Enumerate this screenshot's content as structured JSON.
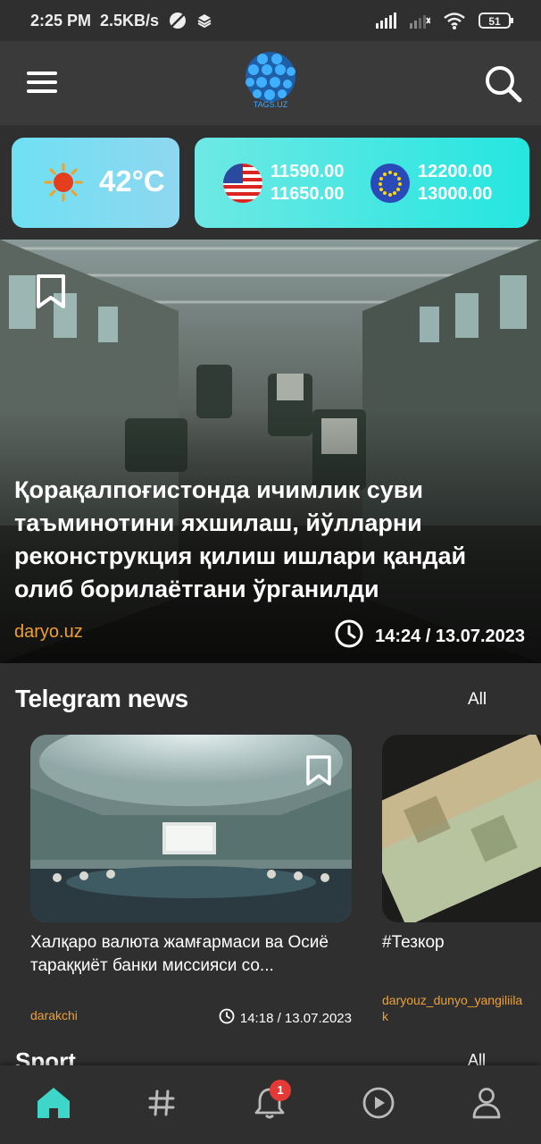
{
  "status_bar": {
    "time": "2:25 PM",
    "speed": "2.5KB/s",
    "battery": "51",
    "icons": [
      "no-sync-icon",
      "layers-icon",
      "signal-icon",
      "signal-weak-icon",
      "wifi-icon",
      "battery-icon"
    ]
  },
  "header": {
    "logo_text": "TAGS.UZ",
    "menu_icon": "hamburger-menu-icon",
    "search_icon": "search-icon"
  },
  "weather": {
    "icon": "sun-icon",
    "temperature": "42°C"
  },
  "currency": {
    "usd": {
      "flag": "usa-flag-icon",
      "buy": "11590.00",
      "sell": "11650.00"
    },
    "eur": {
      "flag": "eu-flag-icon",
      "buy": "12200.00",
      "sell": "13000.00"
    }
  },
  "hero": {
    "title": "Қорақалпоғистонда ичимлик суви таъминотини яхшилаш, йўлларни реконструкция қилиш ишлари қандай олиб борилаётгани ўрганилди",
    "source": "daryo.uz",
    "time": "14:24 / 13.07.2023"
  },
  "telegram_news": {
    "title": "Telegram news",
    "all_label": "All",
    "cards": [
      {
        "title": "Халқаро валюта жамғармаси ва Осиё тараққиёт банки миссияси со...",
        "source": "darakchi",
        "time": "14:18 / 13.07.2023"
      },
      {
        "title": "#Тезкор",
        "source": "daryouz_dunyo_yangiliila k",
        "time": ""
      }
    ]
  },
  "next_section": {
    "title": "Sport",
    "all_label": "All"
  },
  "bottom_nav": {
    "items": [
      "home-icon",
      "hashtag-icon",
      "bell-icon",
      "play-icon",
      "profile-icon"
    ],
    "notification_count": "1",
    "active_color": "#3dd6c8"
  }
}
